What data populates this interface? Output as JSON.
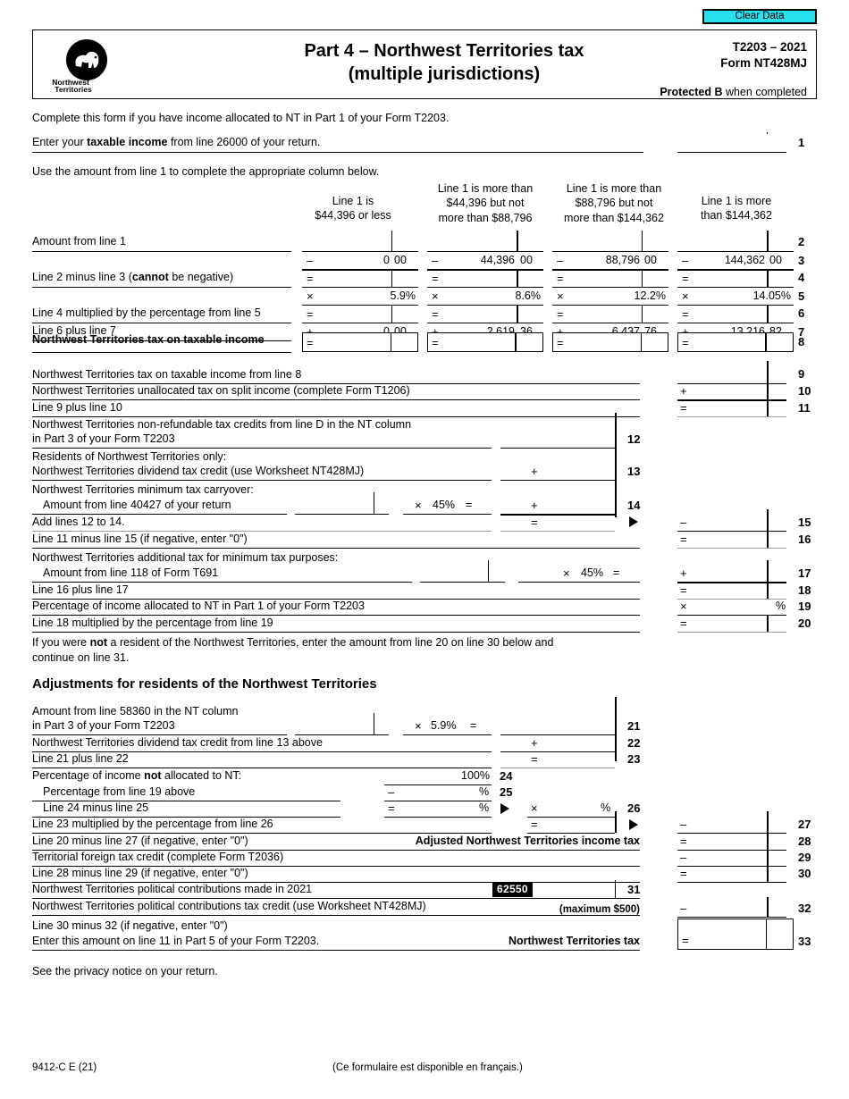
{
  "toolbar": {
    "clear_data_label": "Clear Data"
  },
  "header": {
    "logo_line1": "Northwest",
    "logo_line2": "Territories",
    "title_line1": "Part 4 – Northwest Territories tax",
    "title_line2": "(multiple jurisdictions)",
    "form_year": "T2203 – 2021",
    "form_number": "Form NT428MJ",
    "protected_bold": "Protected B",
    "protected_rest": " when completed"
  },
  "intro": {
    "line_a": "Complete this form if you have income allocated to NT in Part 1 of your Form T2203.",
    "line1_pre": "Enter your ",
    "line1_bold": "taxable income",
    "line1_post": " from line 26000 of your return.",
    "line1_no": "1",
    "line_b": "Use the amount from line 1 to complete the appropriate column below."
  },
  "brackets": {
    "columns": [
      {
        "head_l1": "Line 1 is",
        "head_l2": "$44,396 or less",
        "head_l3": "",
        "line3_value": "0",
        "line3_cents": "00",
        "rate": "5.9%",
        "line7_value": "0",
        "line7_cents": "00"
      },
      {
        "head_l1": "Line 1 is more than",
        "head_l2": "$44,396 but not",
        "head_l3": "more than $88,796",
        "line3_value": "44,396",
        "line3_cents": "00",
        "rate": "8.6%",
        "line7_value": "2,619",
        "line7_cents": "36"
      },
      {
        "head_l1": "Line 1 is more than",
        "head_l2": "$88,796 but not",
        "head_l3": "more than $144,362",
        "line3_value": "88,796",
        "line3_cents": "00",
        "rate": "12.2%",
        "line7_value": "6,437",
        "line7_cents": "76"
      },
      {
        "head_l1": "Line 1 is more",
        "head_l2": "than $144,362",
        "head_l3": "",
        "line3_value": "144,362",
        "line3_cents": "00",
        "rate": "14.05%",
        "line7_value": "13,216",
        "line7_cents": "82"
      }
    ],
    "rows": [
      {
        "no": "2",
        "label_pre": "Amount from line 1",
        "label_bold": "",
        "label_post": "",
        "op": ""
      },
      {
        "no": "3",
        "label_pre": "",
        "label_bold": "",
        "label_post": "",
        "op": "–"
      },
      {
        "no": "4",
        "label_pre": "Line 2 minus line 3 (",
        "label_bold": "cannot",
        "label_post": " be negative)",
        "op": "="
      },
      {
        "no": "5",
        "label_pre": "",
        "label_bold": "",
        "label_post": "",
        "op": "×"
      },
      {
        "no": "6",
        "label_pre": "Line 4 multiplied by the percentage from line 5",
        "label_bold": "",
        "label_post": "",
        "op": "="
      },
      {
        "no": "7",
        "label_pre": "Line 6 plus line 7",
        "label_bold": "",
        "label_post": "",
        "op": "+"
      },
      {
        "no": "8",
        "label_pre": "",
        "label_bold": "Northwest Territories tax on taxable income",
        "label_post": "",
        "op": "="
      }
    ]
  },
  "lines": {
    "l9": {
      "no": "9",
      "label": "Northwest Territories tax on taxable income from line 8",
      "op": ""
    },
    "l10": {
      "no": "10",
      "label": "Northwest Territories unallocated tax on split income (complete Form T1206)",
      "op": "+"
    },
    "l11": {
      "no": "11",
      "label": "Line 9 plus line 10",
      "op": "="
    },
    "l12": {
      "no": "12",
      "label_l1": "Northwest Territories non-refundable tax credits from line D in the NT column",
      "label_l2": "in Part 3 of your Form T2203"
    },
    "l13": {
      "no": "13",
      "label_l1": "Residents of Northwest Territories only:",
      "label_l2": "Northwest Territories dividend tax credit (use Worksheet NT428MJ)",
      "op": "+"
    },
    "l14": {
      "no": "14",
      "label_l1": "Northwest Territories minimum tax carryover:",
      "label_l2": "Amount from line 40427 of your return",
      "mult_op": "×",
      "mult_pct": "45%",
      "eq": "=",
      "op": "+"
    },
    "l15": {
      "no": "15",
      "label": "Add lines 12 to 14.",
      "op_inner": "=",
      "op": "–"
    },
    "l16": {
      "no": "16",
      "label": "Line 11 minus line 15 (if negative, enter \"0\")",
      "op": "="
    },
    "l17": {
      "no": "17",
      "label_l1": "Northwest Territories additional tax for minimum tax purposes:",
      "label_l2": "Amount from line 118 of Form T691",
      "mult_op": "×",
      "mult_pct": "45%",
      "eq": "=",
      "op": "+"
    },
    "l18": {
      "no": "18",
      "label": "Line 16 plus line 17",
      "op": "="
    },
    "l19": {
      "no": "19",
      "label": "Percentage of income allocated to NT in Part 1 of your Form T2203",
      "op": "×",
      "suffix": "%"
    },
    "l20": {
      "no": "20",
      "label": "Line 18 multiplied by the percentage from line 19",
      "op": "="
    }
  },
  "note": {
    "l1_pre": "If you were ",
    "l1_bold": "not",
    "l1_post": " a resident of the Northwest Territories, enter the amount from line 20 on line 30 below and",
    "l2": "continue on line 31."
  },
  "adjust": {
    "section_title": "Adjustments for residents of the Northwest Territories",
    "l21": {
      "no": "21",
      "label_l1": "Amount from line 58360 in the NT column",
      "label_l2": "in Part 3 of your Form T2203",
      "mult_op": "×",
      "mult_pct": "5.9%",
      "eq": "="
    },
    "l22": {
      "no": "22",
      "label": "Northwest Territories dividend tax credit from line 13 above",
      "op": "+"
    },
    "l23": {
      "no": "23",
      "label": "Line 21 plus line 22",
      "op": "="
    },
    "l24": {
      "no": "24",
      "label_pre": "Percentage of income ",
      "label_bold": "not",
      "label_post": " allocated to NT:",
      "value": "100%"
    },
    "l25": {
      "no": "25",
      "label": "Percentage from line 19 above",
      "op": "–",
      "suffix": "%"
    },
    "l26": {
      "no": "26",
      "label": "Line 24 minus line 25",
      "op_inner": "=",
      "suffix_inner": "%",
      "op": "×",
      "suffix": "%"
    },
    "l27": {
      "no": "27",
      "label": "Line 23 multiplied by the percentage from line 26",
      "op_inner": "=",
      "op": "–"
    },
    "l28": {
      "no": "28",
      "label": "Line 20 minus line 27 (if negative, enter \"0\")",
      "caption": "Adjusted Northwest Territories income tax",
      "op": "="
    },
    "l29": {
      "no": "29",
      "label": "Territorial foreign tax credit (complete Form T2036)",
      "op": "–"
    },
    "l30": {
      "no": "30",
      "label": "Line 28 minus line 29 (if negative, enter \"0\")",
      "op": "="
    },
    "l31": {
      "no": "31",
      "label": "Northwest Territories political contributions made in 2021",
      "tag": "62550"
    },
    "l32": {
      "no": "32",
      "label": "Northwest Territories political contributions tax credit (use Worksheet NT428MJ)",
      "caption": "(maximum $500)",
      "op": "–"
    },
    "l33": {
      "no": "33",
      "label_l1": "Line 30 minus 32 (if negative, enter \"0\")",
      "label_l2": "Enter this amount on line 11 in Part 5 of your Form T2203.",
      "caption": "Northwest Territories tax",
      "op": "="
    }
  },
  "footer": {
    "privacy": "See the privacy notice on your return.",
    "code": "9412-C E (21)",
    "french": "(Ce formulaire est disponible en français.)"
  }
}
